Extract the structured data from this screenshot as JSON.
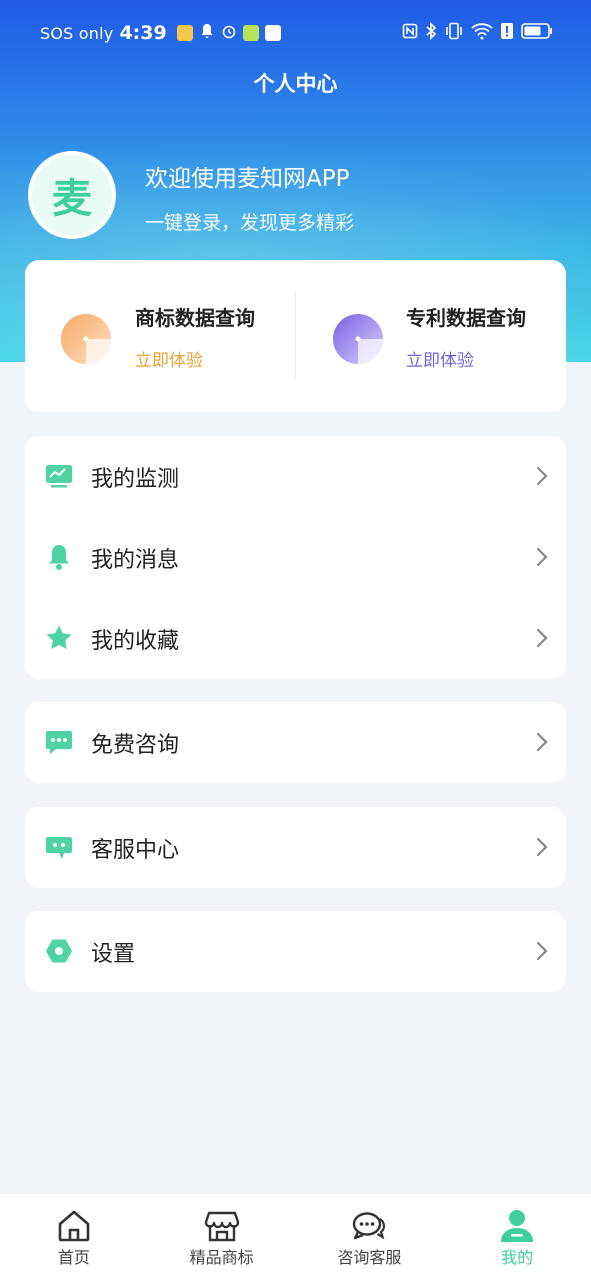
{
  "status_bar": {
    "carrier": "SOS only",
    "time": "4:39"
  },
  "header": {
    "title": "个人中心"
  },
  "profile": {
    "avatar_text": "麦",
    "welcome": "欢迎使用麦知网APP",
    "subtitle": "一键登录，发现更多精彩"
  },
  "queries": [
    {
      "title": "商标数据查询",
      "action": "立即体验",
      "accent": "#e6a33a"
    },
    {
      "title": "专利数据查询",
      "action": "立即体验",
      "accent": "#7763d8"
    }
  ],
  "menu_groups": [
    [
      {
        "label": "我的监测",
        "icon": "monitor-icon"
      },
      {
        "label": "我的消息",
        "icon": "bell-icon"
      },
      {
        "label": "我的收藏",
        "icon": "star-icon"
      }
    ],
    [
      {
        "label": "免费咨询",
        "icon": "chat-icon"
      }
    ],
    [
      {
        "label": "客服中心",
        "icon": "service-icon"
      }
    ],
    [
      {
        "label": "设置",
        "icon": "settings-icon"
      }
    ]
  ],
  "tabs": [
    {
      "label": "首页",
      "icon": "home-icon",
      "active": false
    },
    {
      "label": "精品商标",
      "icon": "shop-icon",
      "active": false
    },
    {
      "label": "咨询客服",
      "icon": "chat-bubbles-icon",
      "active": false
    },
    {
      "label": "我的",
      "icon": "user-icon",
      "active": true
    }
  ],
  "colors": {
    "accent": "#3fcf9f",
    "hero_top": "#1f5be6",
    "hero_bottom": "#4cd6e6"
  }
}
